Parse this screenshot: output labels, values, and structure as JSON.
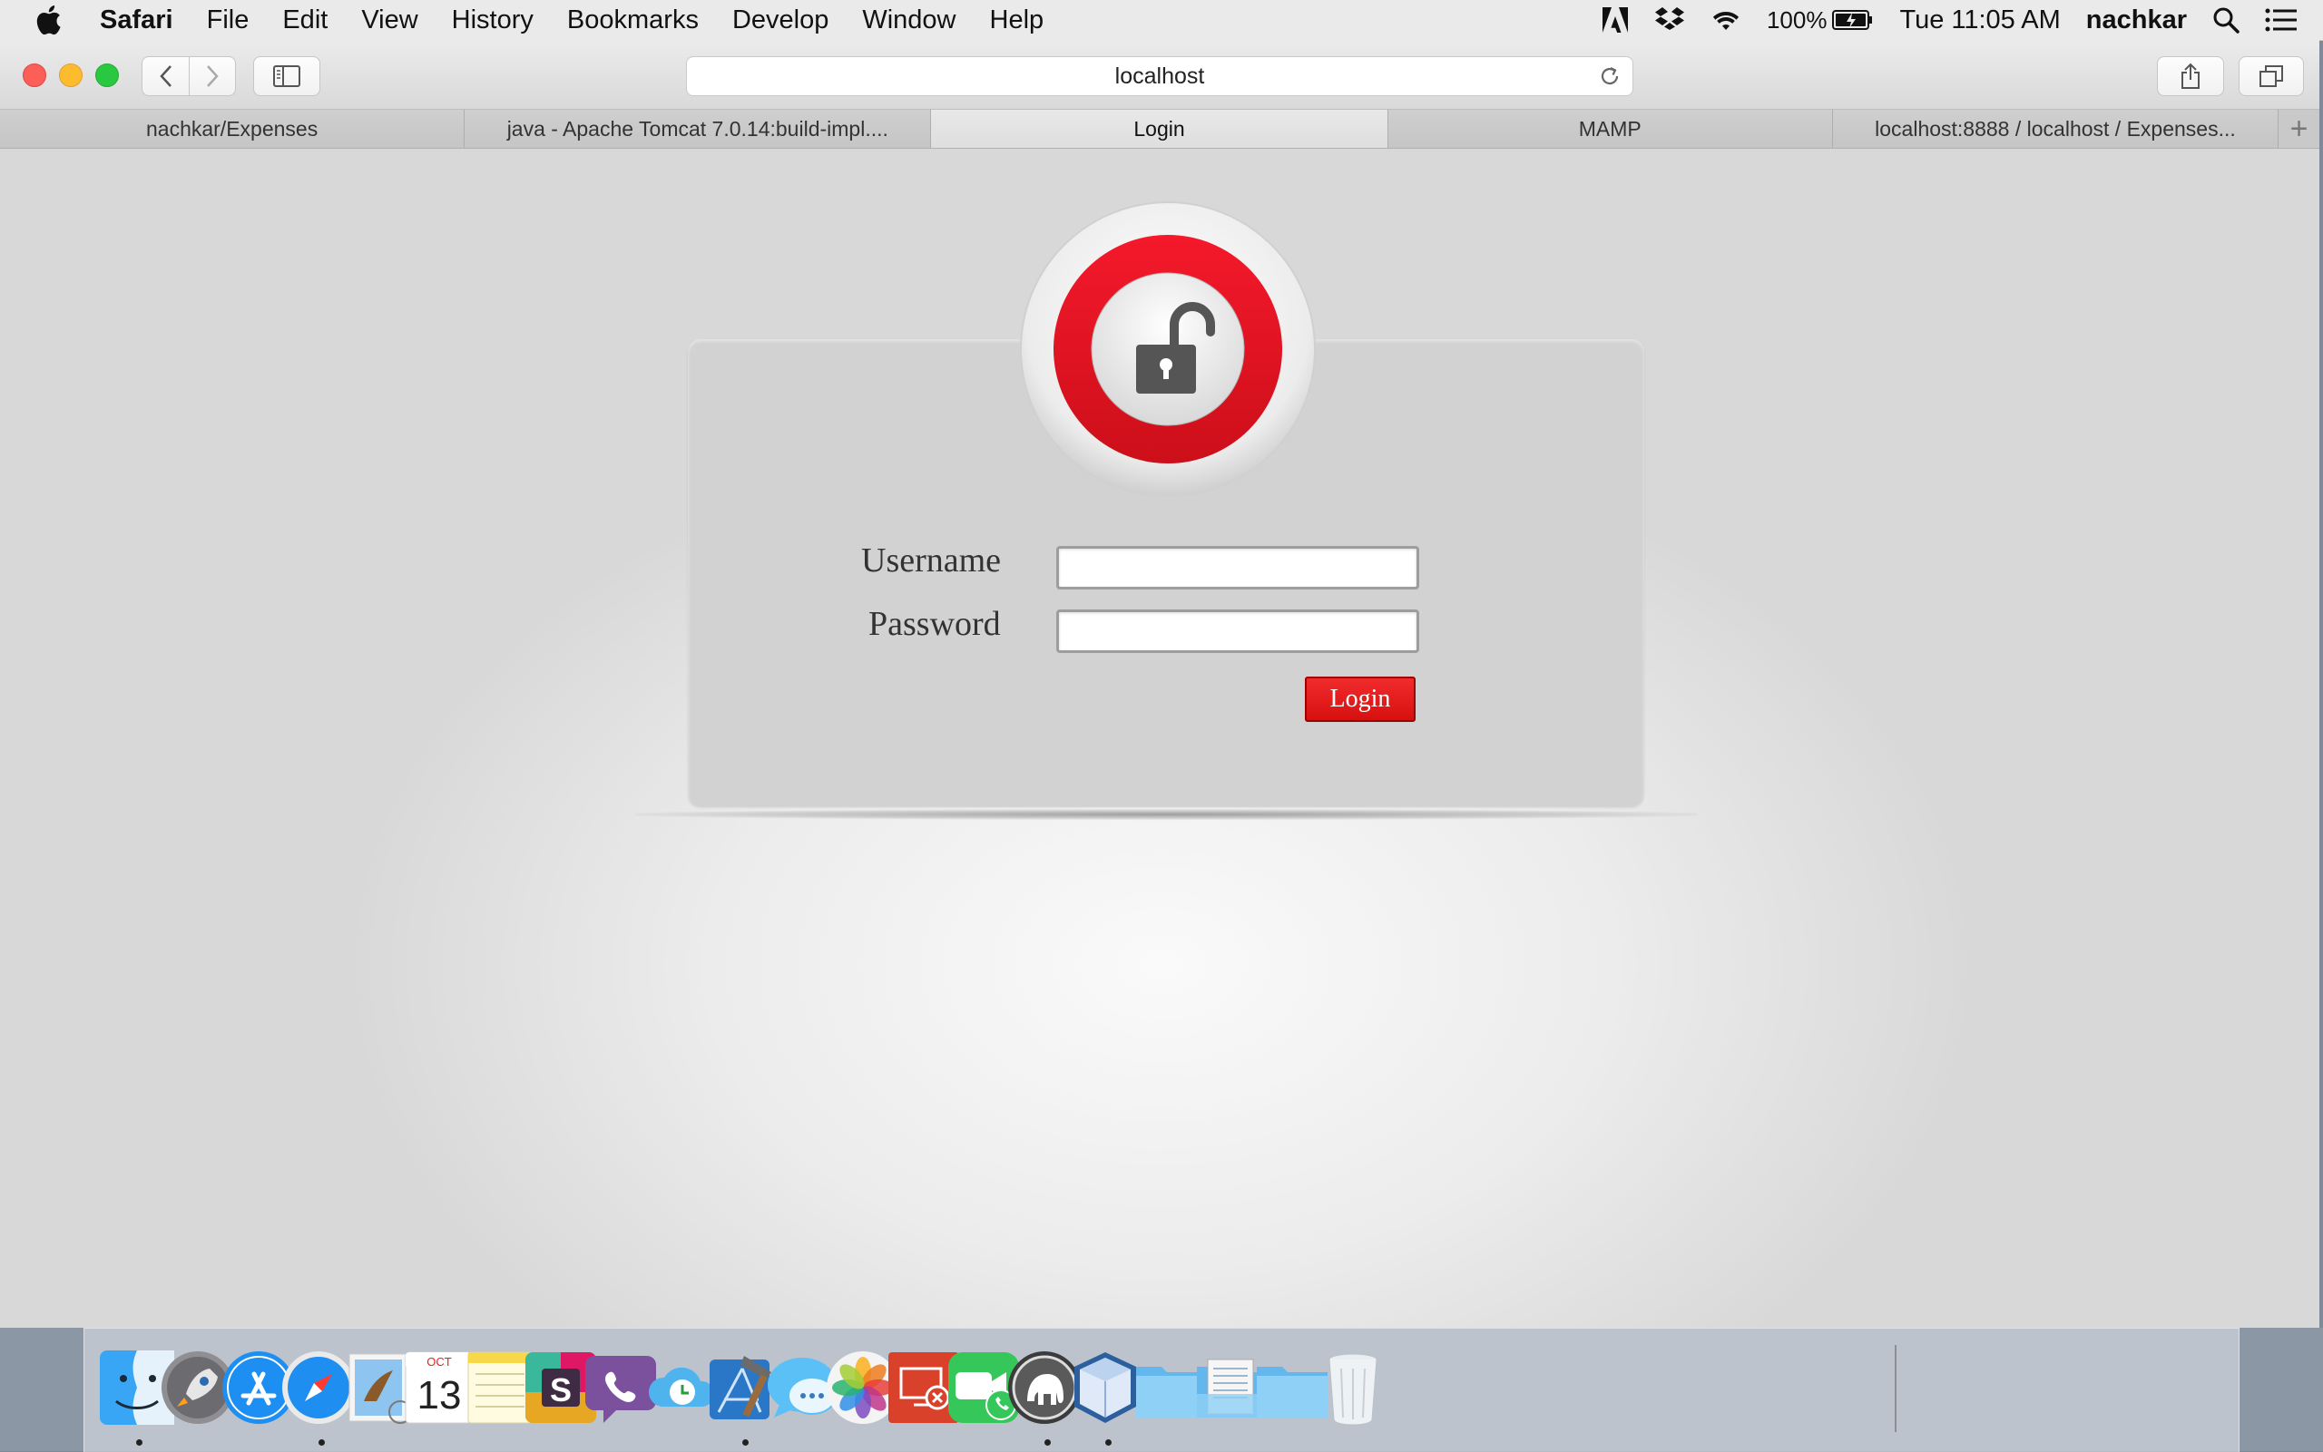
{
  "menubar": {
    "app_name": "Safari",
    "menus": [
      "File",
      "Edit",
      "View",
      "History",
      "Bookmarks",
      "Develop",
      "Window",
      "Help"
    ],
    "battery": "100%",
    "clock": "Tue 11:05 AM",
    "user": "nachkar"
  },
  "browser": {
    "url": "localhost",
    "tabs": [
      {
        "label": "nachkar/Expenses",
        "active": false
      },
      {
        "label": "java - Apache Tomcat 7.0.14:build-impl....",
        "active": false
      },
      {
        "label": "Login",
        "active": true
      },
      {
        "label": "MAMP",
        "active": false
      },
      {
        "label": "localhost:8888 / localhost / Expenses...",
        "active": false
      }
    ]
  },
  "login": {
    "username_label": "Username",
    "password_label": "Password",
    "username_value": "",
    "password_value": "",
    "submit_label": "Login",
    "accent_color": "#e31b1b"
  },
  "dock": {
    "calendar_month": "OCT",
    "calendar_day": "13",
    "items": [
      {
        "name": "finder",
        "running": true
      },
      {
        "name": "launchpad",
        "running": false
      },
      {
        "name": "app-store",
        "running": false
      },
      {
        "name": "safari",
        "running": true
      },
      {
        "name": "mail",
        "running": false
      },
      {
        "name": "calendar",
        "running": false
      },
      {
        "name": "notes",
        "running": false
      },
      {
        "name": "slack",
        "running": false
      },
      {
        "name": "viber",
        "running": false
      },
      {
        "name": "cloud-clock",
        "running": false
      },
      {
        "name": "xcode",
        "running": true
      },
      {
        "name": "messages",
        "running": false
      },
      {
        "name": "photos",
        "running": false
      },
      {
        "name": "remote-desktop",
        "running": false
      },
      {
        "name": "facetime",
        "running": false
      },
      {
        "name": "mamp",
        "running": true
      },
      {
        "name": "virtualbox",
        "running": true
      },
      {
        "name": "folder",
        "running": false
      },
      {
        "name": "documents-stack",
        "running": false
      },
      {
        "name": "folder",
        "running": false
      },
      {
        "name": "trash",
        "running": false
      }
    ]
  }
}
